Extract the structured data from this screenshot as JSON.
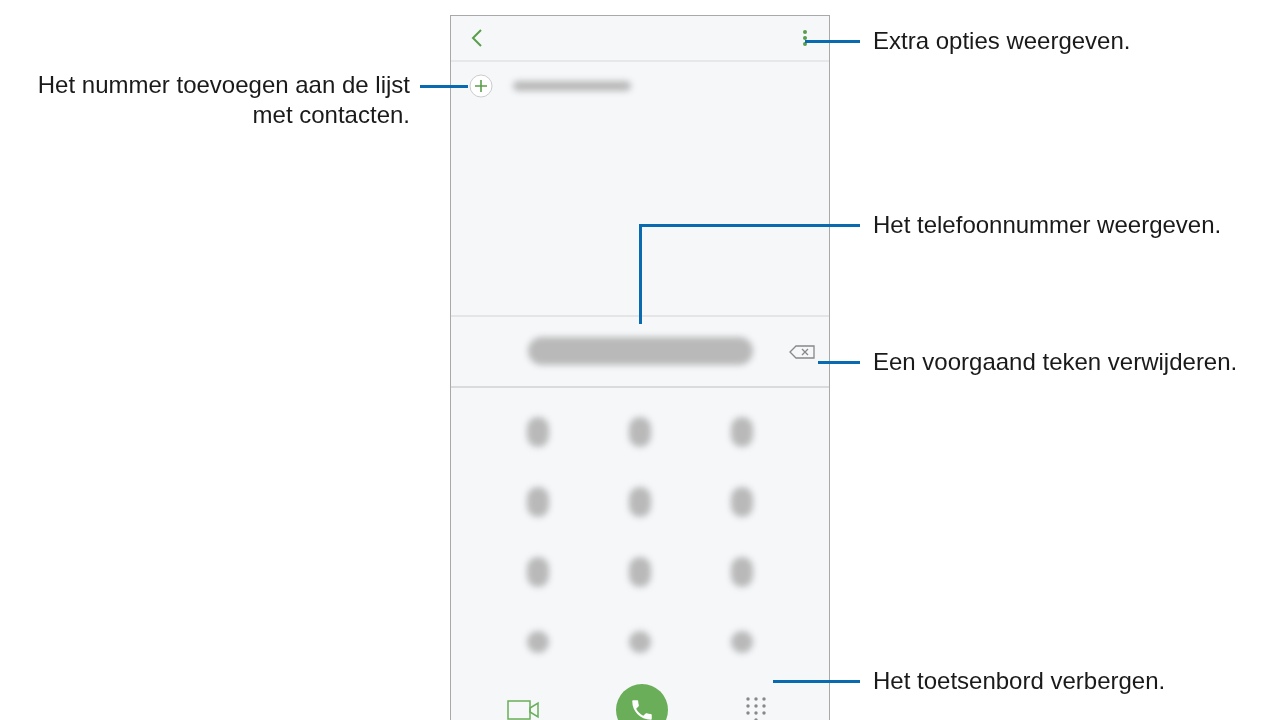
{
  "callouts": [
    {
      "kind": "add-contact",
      "text": "Het nummer toevoegen aan de lijst met contacten."
    },
    {
      "kind": "more-options",
      "text": "Extra opties weergeven."
    },
    {
      "kind": "number",
      "text": "Het telefoonnummer weergeven."
    },
    {
      "kind": "backspace",
      "text": "Een voorgaand teken verwijderen."
    },
    {
      "kind": "keypad",
      "text": "Het toetsenbord verbergen."
    }
  ]
}
